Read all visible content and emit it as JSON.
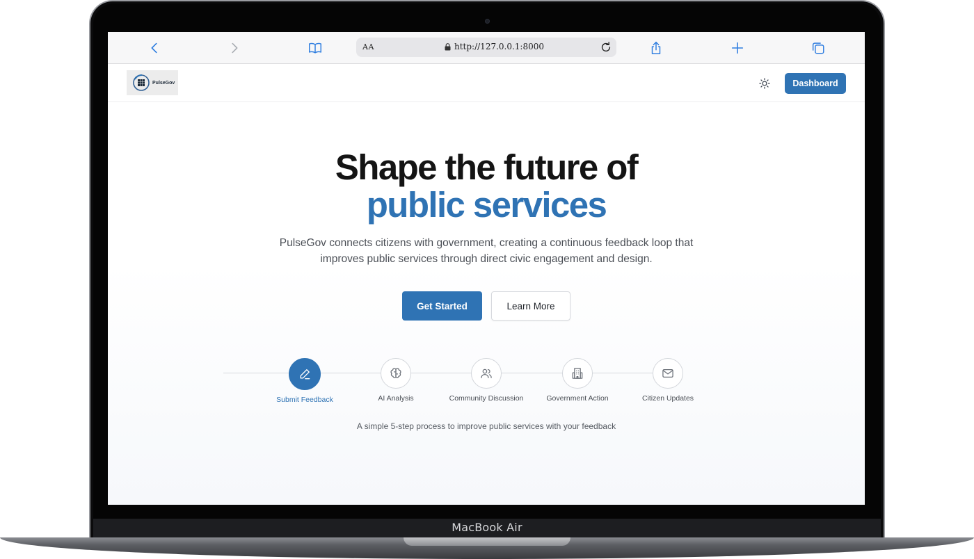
{
  "device": {
    "label": "MacBook Air"
  },
  "browser": {
    "text_size_label": "AA",
    "url": "http://127.0.0.1:8000",
    "icons": [
      "chevron-left-icon",
      "chevron-right-icon",
      "bookmarks-icon",
      "lock-icon",
      "reload-icon",
      "share-icon",
      "plus-icon",
      "tabs-icon"
    ]
  },
  "header": {
    "logo_text": "PulseGov",
    "dashboard_label": "Dashboard",
    "theme_icon": "sun-icon"
  },
  "hero": {
    "title_line1": "Shape the future of",
    "title_line2": "public services",
    "subtitle": "PulseGov connects citizens with government, creating a continuous feedback loop that improves public services through direct civic engagement and design.",
    "primary_cta": "Get Started",
    "secondary_cta": "Learn More"
  },
  "steps": {
    "items": [
      {
        "label": "Submit Feedback",
        "icon": "pencil-icon",
        "active": true
      },
      {
        "label": "AI Analysis",
        "icon": "brain-icon",
        "active": false
      },
      {
        "label": "Community Discussion",
        "icon": "users-icon",
        "active": false
      },
      {
        "label": "Government Action",
        "icon": "building-icon",
        "active": false
      },
      {
        "label": "Citizen Updates",
        "icon": "mail-icon",
        "active": false
      }
    ],
    "caption": "A simple 5-step process to improve public services with your feedback"
  },
  "colors": {
    "accent": "#2f73b4",
    "heading": "#141414",
    "body_text": "#4b4f56"
  }
}
